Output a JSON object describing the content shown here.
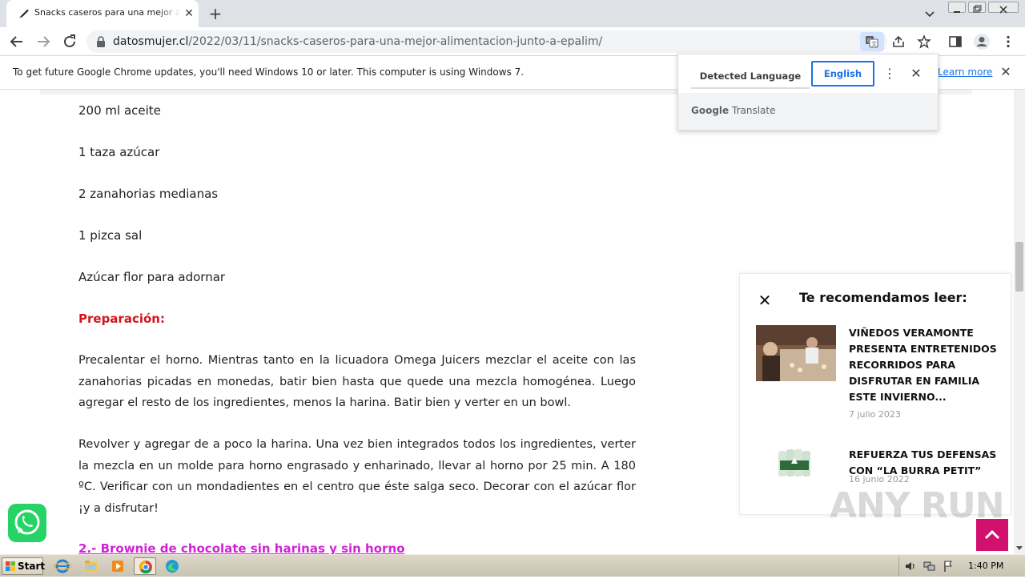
{
  "browser": {
    "tab_title": "Snacks caseros para una mejor alimentación",
    "tab_close": "✕",
    "new_tab": "+",
    "url_host": "datosmujer.cl",
    "url_path": "/2022/03/11/snacks-caseros-para-una-mejor-alimentacion-junto-a-epalim/",
    "icons": [
      "back-arrow-icon",
      "forward-arrow-icon",
      "reload-icon",
      "lock-icon",
      "translate-icon",
      "share-icon",
      "star-icon",
      "side-panel-icon",
      "profile-icon",
      "kebab-menu-icon"
    ]
  },
  "infobar": {
    "text": "To get future Google Chrome updates, you'll need Windows 10 or later. This computer is using Windows 7.",
    "learn_more": "Learn more",
    "close": "✕"
  },
  "translate_popup": {
    "detected_tab": "Detected Language",
    "english_tab": "English",
    "menu": "⋮",
    "close": "✕",
    "brand_google": "Google",
    "brand_translate": "Translate"
  },
  "article": {
    "ingredients": [
      "200 ml aceite",
      "1 taza azúcar",
      "2 zanahorias medianas",
      "1 pizca sal",
      "Azúcar flor para adornar"
    ],
    "prep_heading": "Preparación:",
    "paragraphs": [
      "Precalentar el horno. Mientras tanto en la licuadora Omega Juicers mezclar el aceite con las zanahorias picadas en monedas, batir bien hasta que quede una mezcla homogénea. Luego agregar el resto de los ingredientes, menos la harina. Batir bien y verter en un bowl.",
      "Revolver y agregar de a poco la harina. Una vez bien integrados todos los ingredientes, verter la mezcla en un molde para horno engrasado y enharinado, llevar al horno por 25 min. A 180 ºC. Verificar con un mondadientes en el centro que éste salga seco. Decorar con el azúcar flor ¡y a disfrutar!"
    ],
    "next_heading": "2.- Brownie de chocolate sin harinas y sin horno",
    "colors": {
      "prep": "#d4141b",
      "next": "#d321d6"
    }
  },
  "recommend": {
    "close": "✕",
    "heading": "Te recomendamos leer:",
    "items": [
      {
        "title": "VIÑEDOS VERAMONTE PRESENTA ENTRETENIDOS RECORRIDOS PARA DISFRUTAR EN FAMILIA ESTE INVIERNO...",
        "date": "7 julio 2023"
      },
      {
        "title": "REFUERZA TUS DEFENSAS CON “LA BURRA PETIT”",
        "date": "16 junio 2022"
      }
    ]
  },
  "watermark": "ANY RUN",
  "taskbar": {
    "start": "Start",
    "clock": "1:40 PM",
    "apps": [
      "ie-icon",
      "explorer-icon",
      "media-player-icon",
      "chrome-icon",
      "edge-icon"
    ]
  }
}
